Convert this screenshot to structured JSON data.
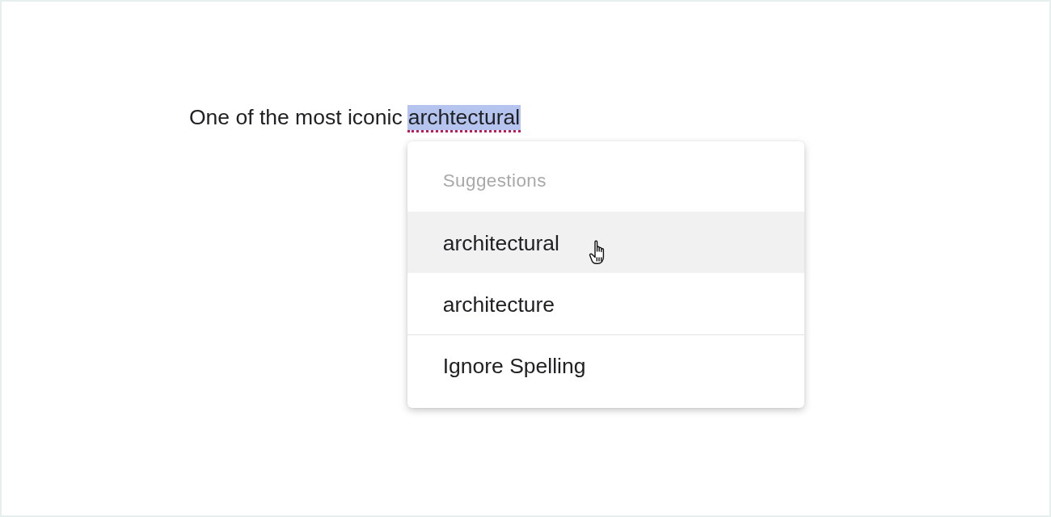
{
  "document": {
    "text_before": "One of the most iconic",
    "word": {
      "text": "archtectural",
      "selected": true,
      "misspelled": true
    }
  },
  "context_menu": {
    "header": "Suggestions",
    "items": [
      {
        "label": "architectural",
        "kind": "suggestion",
        "hovered": true
      },
      {
        "label": "architecture",
        "kind": "suggestion",
        "hovered": false
      },
      {
        "label": "Ignore Spelling",
        "kind": "action",
        "hovered": false
      }
    ]
  }
}
